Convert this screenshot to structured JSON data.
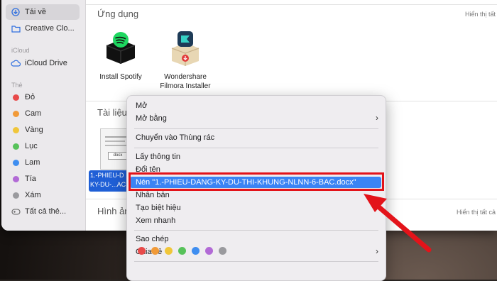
{
  "sidebar": {
    "items_top": [
      {
        "label": "Tải về",
        "icon": "download-circle-icon"
      },
      {
        "label": "Creative Clo...",
        "icon": "folder-icon"
      }
    ],
    "icloud_heading": "iCloud",
    "icloud_items": [
      {
        "label": "iCloud Drive",
        "icon": "cloud-icon"
      }
    ],
    "tags_heading": "Thẻ",
    "tags": [
      {
        "label": "Đỏ",
        "color": "#e84a4a"
      },
      {
        "label": "Cam",
        "color": "#f19a38"
      },
      {
        "label": "Vàng",
        "color": "#f0c63a"
      },
      {
        "label": "Lục",
        "color": "#57c25a"
      },
      {
        "label": "Lam",
        "color": "#3f8ef0"
      },
      {
        "label": "Tía",
        "color": "#b26ad6"
      },
      {
        "label": "Xám",
        "color": "#9a9a9e"
      },
      {
        "label": "Tất cả thẻ...",
        "icon": "tags-icon"
      }
    ]
  },
  "main": {
    "apps_title": "Ứng dụng",
    "show_all": "Hiển thị tất",
    "apps": [
      {
        "label": "Install Spotify"
      },
      {
        "label_line1": "Wondershare",
        "label_line2": "Filmora Installer"
      }
    ],
    "docs_title": "Tài liệu",
    "doc_selected_line1": "1.-PHIEU-D",
    "doc_selected_line2": "KY-DU-...AC",
    "images_title": "Hình ản",
    "show_all_2": "Hiển thị tất cả"
  },
  "menu": {
    "items": [
      {
        "label": "Mở"
      },
      {
        "label": "Mở bằng",
        "submenu": true
      },
      {
        "label": "Chuyển vào Thùng rác"
      },
      {
        "label": "Lấy thông tin"
      },
      {
        "label": "Đổi tên"
      },
      {
        "label": "Nén \"1.-PHIEU-DANG-KY-DU-THI-KHUNG-NLNN-6-BAC.docx\"",
        "highlighted": true
      },
      {
        "label": "Nhân bản"
      },
      {
        "label": "Tạo biệt hiệu"
      },
      {
        "label": "Xem nhanh"
      },
      {
        "label": "Sao chép"
      },
      {
        "label": "Chia sẻ",
        "submenu": true
      }
    ],
    "tag_colors": [
      "#e84a4a",
      "#f19a38",
      "#f0c63a",
      "#57c25a",
      "#3f8ef0",
      "#b26ad6",
      "#9a9a9e"
    ]
  },
  "annotation": {
    "box_color": "#e3131a",
    "arrow_color": "#e3131a"
  }
}
